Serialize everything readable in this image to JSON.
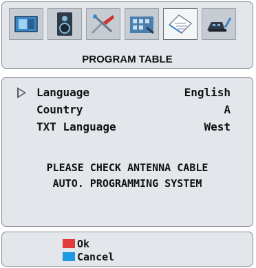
{
  "menu": {
    "title": "PROGRAM TABLE",
    "icons": [
      "picture-icon",
      "sound-icon",
      "tools-icon",
      "install-icon",
      "program-table-icon",
      "source-icon"
    ],
    "active_icon": "program-table-icon"
  },
  "settings": [
    {
      "label": "Language",
      "value": "English"
    },
    {
      "label": "Country",
      "value": "A"
    },
    {
      "label": "TXT Language",
      "value": "West"
    }
  ],
  "messages": [
    "PLEASE CHECK ANTENNA CABLE",
    "AUTO. PROGRAMMING SYSTEM"
  ],
  "footer": {
    "ok_label": "Ok",
    "ok_color": "#e03a3a",
    "cancel_label": "Cancel",
    "cancel_color": "#1e9be0"
  },
  "colors": {
    "panel_bg": "#e3e6ea",
    "panel_border": "#8a8f96",
    "pointer": "#555a61"
  }
}
